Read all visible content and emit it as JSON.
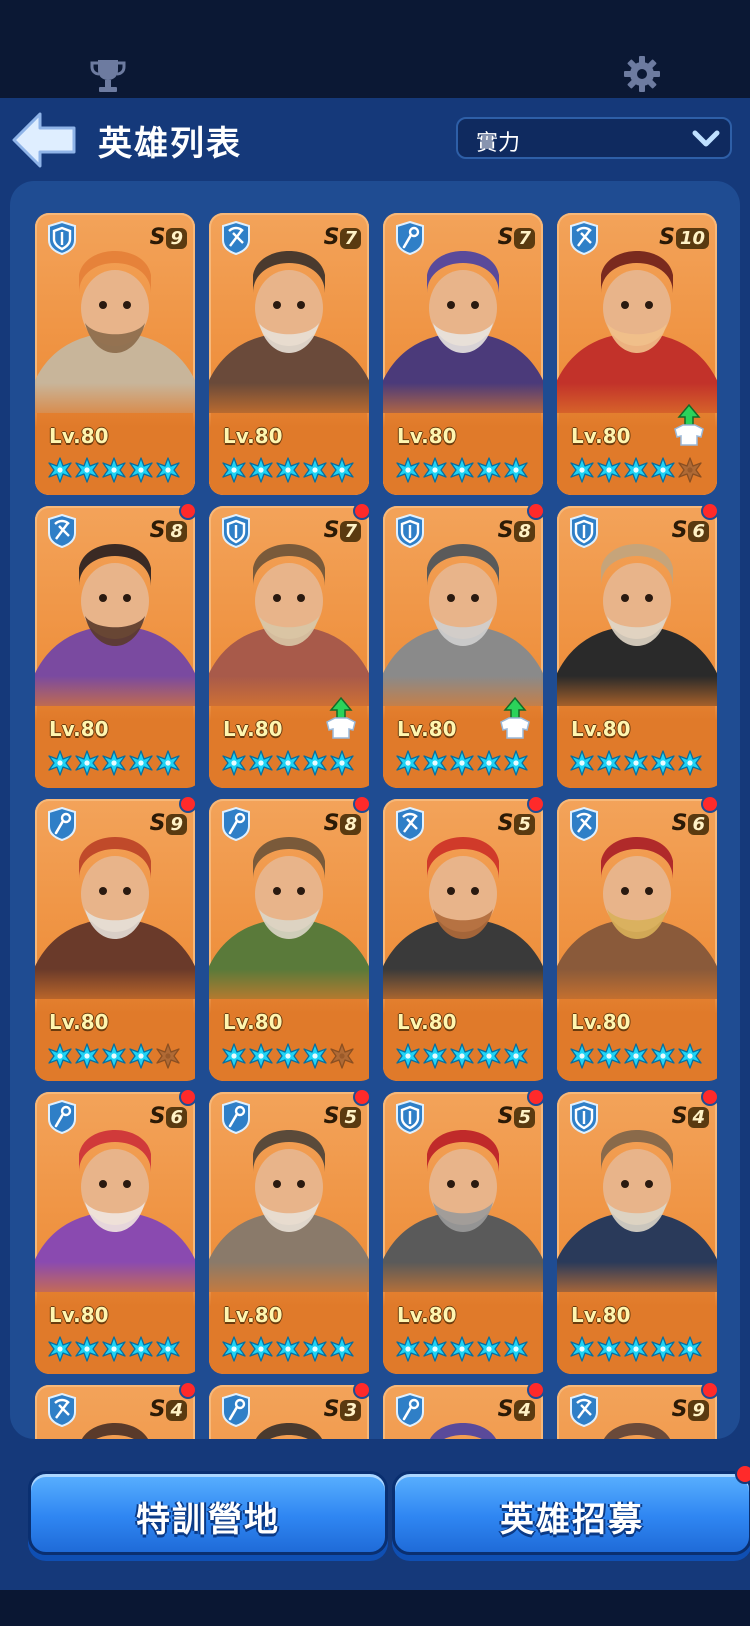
{
  "header": {
    "title": "英雄列表",
    "sort_label": "實力"
  },
  "buttons": {
    "training_label": "特訓營地",
    "recruit_label": "英雄招募"
  },
  "colors": {
    "card_orange": "#ee8f3c",
    "star_cyan": "#1fd3f5",
    "notif_red": "#ff2a2a",
    "bg_blue": "#15397a"
  },
  "heroes": [
    {
      "class": "shield",
      "rank_s": "S",
      "rank_n": "9",
      "level": "Lv.80",
      "stars": 5,
      "dot": false,
      "upgrade": false
    },
    {
      "class": "crossbow",
      "rank_s": "S",
      "rank_n": "7",
      "level": "Lv.80",
      "stars": 5,
      "dot": false,
      "upgrade": false
    },
    {
      "class": "staff",
      "rank_s": "S",
      "rank_n": "7",
      "level": "Lv.80",
      "stars": 5,
      "dot": false,
      "upgrade": false
    },
    {
      "class": "crossbow",
      "rank_s": "S",
      "rank_n": "10",
      "level": "Lv.80",
      "stars": 4,
      "dot": false,
      "upgrade": true
    },
    {
      "class": "crossbow",
      "rank_s": "S",
      "rank_n": "8",
      "level": "Lv.80",
      "stars": 5,
      "dot": true,
      "upgrade": false
    },
    {
      "class": "shield",
      "rank_s": "S",
      "rank_n": "7",
      "level": "Lv.80",
      "stars": 5,
      "dot": true,
      "upgrade": true
    },
    {
      "class": "shield",
      "rank_s": "S",
      "rank_n": "8",
      "level": "Lv.80",
      "stars": 5,
      "dot": true,
      "upgrade": true
    },
    {
      "class": "shield",
      "rank_s": "S",
      "rank_n": "6",
      "level": "Lv.80",
      "stars": 5,
      "dot": true,
      "upgrade": false
    },
    {
      "class": "staff",
      "rank_s": "S",
      "rank_n": "9",
      "level": "Lv.80",
      "stars": 4,
      "dot": true,
      "upgrade": false
    },
    {
      "class": "staff",
      "rank_s": "S",
      "rank_n": "8",
      "level": "Lv.80",
      "stars": 4,
      "dot": true,
      "upgrade": false
    },
    {
      "class": "crossbow",
      "rank_s": "S",
      "rank_n": "5",
      "level": "Lv.80",
      "stars": 5,
      "dot": true,
      "upgrade": false
    },
    {
      "class": "crossbow",
      "rank_s": "S",
      "rank_n": "6",
      "level": "Lv.80",
      "stars": 5,
      "dot": true,
      "upgrade": false
    },
    {
      "class": "staff",
      "rank_s": "S",
      "rank_n": "6",
      "level": "Lv.80",
      "stars": 5,
      "dot": true,
      "upgrade": false
    },
    {
      "class": "staff",
      "rank_s": "S",
      "rank_n": "5",
      "level": "Lv.80",
      "stars": 5,
      "dot": true,
      "upgrade": false
    },
    {
      "class": "shield",
      "rank_s": "S",
      "rank_n": "5",
      "level": "Lv.80",
      "stars": 5,
      "dot": true,
      "upgrade": false
    },
    {
      "class": "shield",
      "rank_s": "S",
      "rank_n": "4",
      "level": "Lv.80",
      "stars": 5,
      "dot": true,
      "upgrade": false
    },
    {
      "class": "crossbow",
      "rank_s": "S",
      "rank_n": "4",
      "level": "",
      "stars": 0,
      "dot": true,
      "upgrade": false
    },
    {
      "class": "staff",
      "rank_s": "S",
      "rank_n": "3",
      "level": "",
      "stars": 0,
      "dot": true,
      "upgrade": false
    },
    {
      "class": "staff",
      "rank_s": "S",
      "rank_n": "4",
      "level": "",
      "stars": 0,
      "dot": true,
      "upgrade": false
    },
    {
      "class": "crossbow",
      "rank_s": "S",
      "rank_n": "9",
      "level": "",
      "stars": 0,
      "dot": true,
      "upgrade": false
    }
  ]
}
